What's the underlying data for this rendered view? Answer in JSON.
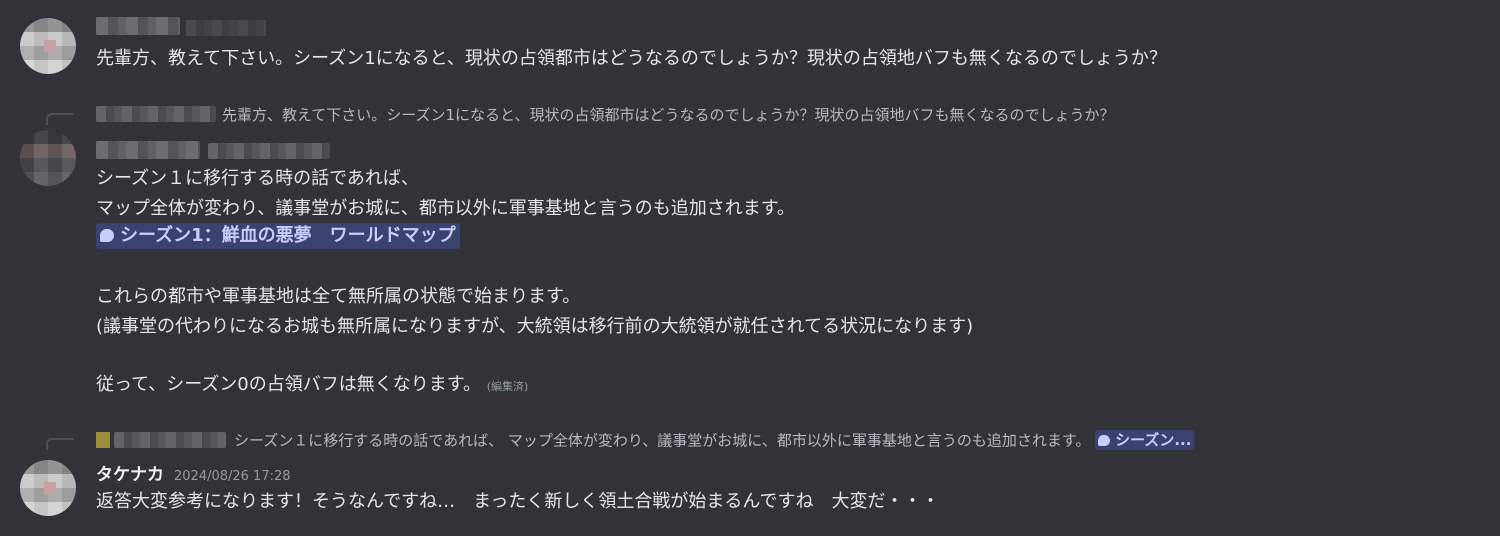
{
  "messages": [
    {
      "text": "先輩方、教えて下さい。シーズン1になると、現状の占領都市はどうなるのでしょうか？現状の占領地バフも無くなるのでしょうか？"
    },
    {
      "reply_preview": "先輩方、教えて下さい。シーズン1になると、現状の占領都市はどうなるのでしょうか？現状の占領地バフも無くなるのでしょうか？",
      "lines": [
        "シーズン１に移行する時の話であれば、",
        "マップ全体が変わり、議事堂がお城に、都市以外に軍事基地と言うのも追加されます。"
      ],
      "channel_mention": "シーズン1：鮮血の悪夢　ワールドマップ",
      "lines2": [
        "これらの都市や軍事基地は全て無所属の状態で始まります。",
        "(議事堂の代わりになるお城も無所属になりますが、大統領は移行前の大統領が就任されてる状況になります)"
      ],
      "line3": "従って、シーズン0の占領バフは無くなります。",
      "edited_label": "(編集済)"
    },
    {
      "reply_preview": "シーズン１に移行する時の話であれば、 マップ全体が変わり、議事堂がお城に、都市以外に軍事基地と言うのも追加されます。",
      "reply_mention": "シーズン...",
      "username": "タケナカ",
      "timestamp": "2024/08/26 17:28",
      "text": "返答大変参考になります！そうなんですね…　まったく新しく領土合戦が始まるんですね　大変だ・・・"
    }
  ],
  "colors": {
    "background": "#313338",
    "text": "#e3e5e8",
    "mention_bg": "#3c4270",
    "mention_text": "#c9cdfb"
  }
}
